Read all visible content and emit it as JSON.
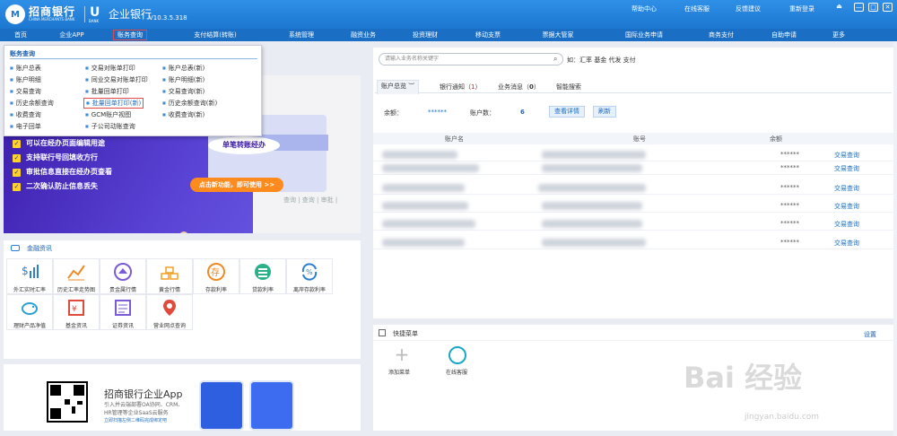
{
  "header": {
    "logo_text": "M",
    "brand": "招商银行",
    "brand_en": "CHINA MERCHANTS BANK",
    "ebank_icon": "U",
    "ebank_icon_sub": "BANK",
    "ebank_title": "企业银行",
    "version": "V10.3.5.318",
    "links": [
      "帮助中心",
      "在线客服",
      "反馈建议",
      "重新登录"
    ],
    "window_controls": [
      "⏏",
      "—",
      "□",
      "✕"
    ]
  },
  "menu": {
    "items": [
      "首页",
      "企业APP",
      "账务查询",
      "支付结算(转账)",
      "系统管理",
      "融资业务",
      "投资理财",
      "移动支票",
      "票据大管家",
      "国际业务申请",
      "商务支付",
      "自助申请",
      "更多"
    ],
    "active": "账务查询"
  },
  "dropdown": {
    "title": "账务查询",
    "col1": [
      "账户总表",
      "账户明细",
      "交易查询",
      "历史余额查询",
      "收费查询",
      "电子回单"
    ],
    "col2": [
      "交易对账单打印",
      "同业交易对账单打印",
      "批量回单打印",
      "批量回单打印(新)",
      "GCM账户视图",
      "子公司动账查询"
    ],
    "col3": [
      "账户总表(新)",
      "账户明细(新)",
      "交易查询(新)",
      "历史余额查询(新)",
      "收费查询(新)"
    ]
  },
  "banner": {
    "bullets": [
      "可以在经办页面编辑用途",
      "支持联行号回填收方行",
      "审批信息直接在经办页查看",
      "二次确认防止信息丢失"
    ],
    "bubble": "单笔转账经办",
    "cta": "点击新功能，即可使用 >>",
    "bg_tabs": "查询 | 查询 | 审批 |"
  },
  "finance": {
    "title": "金融资讯",
    "tiles": [
      "外汇实时汇率",
      "历史汇率走势图",
      "贵金属行情",
      "黄金行情",
      "存款利率",
      "贷款利率",
      "离岸存款利率",
      "理财产品净值",
      "基金资讯",
      "证券资讯",
      "营业网点查询"
    ],
    "tile_icons": [
      "exchange-rate-icon",
      "trend-chart-icon",
      "precious-metal-icon",
      "gold-bars-icon",
      "deposit-rate-icon",
      "loan-rate-icon",
      "offshore-rate-icon",
      "wealth-product-icon",
      "fund-icon",
      "securities-icon",
      "branch-location-icon"
    ]
  },
  "app_promo": {
    "title": "招商银行企业App",
    "desc1": "引入并云端部署OA协同、CRM、",
    "desc2": "HR管理等企业SaaS云服务",
    "desc3": "立即扫描左侧二维码完成绑定吧"
  },
  "search": {
    "placeholder": "请输入业务名称关键字",
    "hint": "如：汇率 基金 代发 支付"
  },
  "account": {
    "tabs": [
      {
        "label": "账户总览",
        "count": ""
      },
      {
        "label": "银行通知",
        "count": "1"
      },
      {
        "label": "业务消息",
        "count": "0"
      },
      {
        "label": "智能搜索",
        "count": ""
      }
    ],
    "balance_label": "余额：",
    "balance_value": "******",
    "count_label": "账户数：",
    "count_value": "6",
    "btn_detail": "查看详情",
    "btn_refresh": "刷新",
    "columns": [
      "账户名",
      "账号",
      "余额",
      ""
    ],
    "rows": [
      {
        "balance": "******",
        "action": "交易查询"
      },
      {
        "balance": "******",
        "action": "交易查询"
      },
      {
        "balance": "******",
        "action": "交易查询"
      },
      {
        "balance": "******",
        "action": "交易查询"
      },
      {
        "balance": "******",
        "action": "交易查询"
      },
      {
        "balance": "******",
        "action": "交易查询"
      }
    ]
  },
  "quick_menu": {
    "title": "快捷菜单",
    "settings": "设置",
    "add_label": "添加菜单",
    "service_label": "在线客服"
  },
  "watermark": {
    "main": "Bai 经验",
    "sub": "jingyan.baidu.com"
  }
}
